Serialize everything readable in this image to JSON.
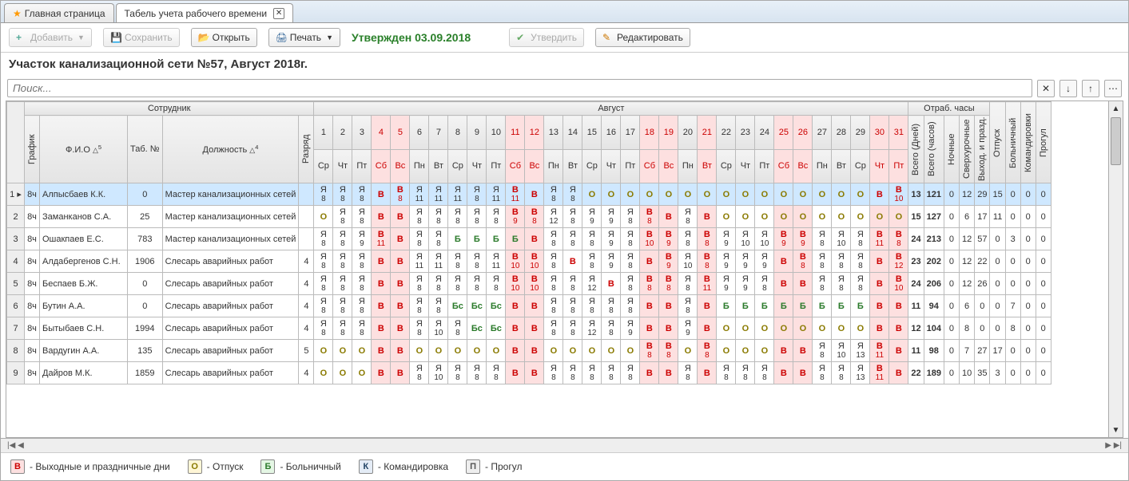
{
  "tabs": [
    {
      "label": "Главная страница",
      "star": true,
      "active": false
    },
    {
      "label": "Табель учета рабочего времени",
      "active": true,
      "closable": true
    }
  ],
  "toolbar": {
    "add": "Добавить",
    "save": "Сохранить",
    "open": "Открыть",
    "print": "Печать",
    "approve": "Утвердить",
    "edit": "Редактировать"
  },
  "status": "Утвержден 03.09.2018",
  "title": "Участок канализационной сети №57, Август 2018г.",
  "search_placeholder": "Поиск...",
  "month_label": "Август",
  "headers": {
    "employee": "Сотрудник",
    "schedule": "График",
    "fio": "Ф.И.О",
    "tabno": "Таб. №",
    "position": "Должность",
    "rank": "Разряд",
    "hours_group": "Отраб. часы",
    "days_total": "Всего (Дней)",
    "hours_total": "Всего (часов)",
    "night": "Ночные",
    "overtime": "Сверхурочные",
    "holiday": "Выход. и празд.",
    "vacation": "Отпуск",
    "sick": "Больничный",
    "trip": "Командировки",
    "absence": "Прогул"
  },
  "days": [
    {
      "n": "1",
      "w": "Ср"
    },
    {
      "n": "2",
      "w": "Чт"
    },
    {
      "n": "3",
      "w": "Пт"
    },
    {
      "n": "4",
      "w": "Сб",
      "wk": true
    },
    {
      "n": "5",
      "w": "Вс",
      "wk": true
    },
    {
      "n": "6",
      "w": "Пн"
    },
    {
      "n": "7",
      "w": "Вт"
    },
    {
      "n": "8",
      "w": "Ср"
    },
    {
      "n": "9",
      "w": "Чт"
    },
    {
      "n": "10",
      "w": "Пт"
    },
    {
      "n": "11",
      "w": "Сб",
      "wk": true
    },
    {
      "n": "12",
      "w": "Вс",
      "wk": true
    },
    {
      "n": "13",
      "w": "Пн"
    },
    {
      "n": "14",
      "w": "Вт"
    },
    {
      "n": "15",
      "w": "Ср"
    },
    {
      "n": "16",
      "w": "Чт"
    },
    {
      "n": "17",
      "w": "Пт"
    },
    {
      "n": "18",
      "w": "Сб",
      "wk": true
    },
    {
      "n": "19",
      "w": "Вс",
      "wk": true
    },
    {
      "n": "20",
      "w": "Пн"
    },
    {
      "n": "21",
      "w": "Вт",
      "wk": true
    },
    {
      "n": "22",
      "w": "Ср"
    },
    {
      "n": "23",
      "w": "Чт"
    },
    {
      "n": "24",
      "w": "Пт"
    },
    {
      "n": "25",
      "w": "Сб",
      "wk": true
    },
    {
      "n": "26",
      "w": "Вс",
      "wk": true
    },
    {
      "n": "27",
      "w": "Пн"
    },
    {
      "n": "28",
      "w": "Вт"
    },
    {
      "n": "29",
      "w": "Ср"
    },
    {
      "n": "30",
      "w": "Чт",
      "wk": true
    },
    {
      "n": "31",
      "w": "Пт",
      "wk": true
    }
  ],
  "rows": [
    {
      "n": 1,
      "sel": true,
      "sched": "8ч",
      "fio": "Алпысбаев К.К.",
      "tab": "0",
      "pos": "Мастер канализационных сетей",
      "rank": "",
      "cells": [
        [
          "Я",
          "8"
        ],
        [
          "Я",
          "8"
        ],
        [
          "Я",
          "8"
        ],
        [
          "В",
          ""
        ],
        [
          "В",
          "8"
        ],
        [
          "Я",
          "11"
        ],
        [
          "Я",
          "11"
        ],
        [
          "Я",
          "11"
        ],
        [
          "Я",
          "8"
        ],
        [
          "Я",
          "11"
        ],
        [
          "В",
          "11"
        ],
        [
          "В",
          ""
        ],
        [
          "Я",
          "8"
        ],
        [
          "Я",
          "8"
        ],
        [
          "О",
          ""
        ],
        [
          "О",
          ""
        ],
        [
          "О",
          ""
        ],
        [
          "О",
          ""
        ],
        [
          "О",
          ""
        ],
        [
          "О",
          ""
        ],
        [
          "О",
          ""
        ],
        [
          "О",
          ""
        ],
        [
          "О",
          ""
        ],
        [
          "О",
          ""
        ],
        [
          "О",
          ""
        ],
        [
          "О",
          ""
        ],
        [
          "О",
          ""
        ],
        [
          "О",
          ""
        ],
        [
          "О",
          ""
        ],
        [
          "В",
          ""
        ],
        [
          "В",
          "10"
        ]
      ],
      "totals": [
        "13",
        "121",
        "0",
        "12",
        "29",
        "15",
        "0",
        "0",
        "0"
      ]
    },
    {
      "n": 2,
      "sched": "8ч",
      "fio": "Заманканов С.А.",
      "tab": "25",
      "pos": "Мастер канализационных сетей",
      "rank": "",
      "cells": [
        [
          "О",
          ""
        ],
        [
          "Я",
          "8"
        ],
        [
          "Я",
          "8"
        ],
        [
          "В",
          ""
        ],
        [
          "В",
          ""
        ],
        [
          "Я",
          "8"
        ],
        [
          "Я",
          "8"
        ],
        [
          "Я",
          "8"
        ],
        [
          "Я",
          "8"
        ],
        [
          "Я",
          "8"
        ],
        [
          "В",
          "9"
        ],
        [
          "В",
          "8"
        ],
        [
          "Я",
          "12"
        ],
        [
          "Я",
          "8"
        ],
        [
          "Я",
          "9"
        ],
        [
          "Я",
          "9"
        ],
        [
          "Я",
          "8"
        ],
        [
          "В",
          "8"
        ],
        [
          "В",
          ""
        ],
        [
          "Я",
          "8"
        ],
        [
          "В",
          ""
        ],
        [
          "О",
          ""
        ],
        [
          "О",
          ""
        ],
        [
          "О",
          ""
        ],
        [
          "О",
          ""
        ],
        [
          "О",
          ""
        ],
        [
          "О",
          ""
        ],
        [
          "О",
          ""
        ],
        [
          "О",
          ""
        ],
        [
          "О",
          ""
        ],
        [
          "О",
          ""
        ]
      ],
      "totals": [
        "15",
        "127",
        "0",
        "6",
        "17",
        "11",
        "0",
        "0",
        "0"
      ]
    },
    {
      "n": 3,
      "sched": "8ч",
      "fio": "Ошакпаев Е.С.",
      "tab": "783",
      "pos": "Мастер канализационных сетей",
      "rank": "",
      "cells": [
        [
          "Я",
          "8"
        ],
        [
          "Я",
          "8"
        ],
        [
          "Я",
          "9"
        ],
        [
          "В",
          "11"
        ],
        [
          "В",
          ""
        ],
        [
          "Я",
          "8"
        ],
        [
          "Я",
          "8"
        ],
        [
          "Б",
          ""
        ],
        [
          "Б",
          ""
        ],
        [
          "Б",
          ""
        ],
        [
          "Б",
          ""
        ],
        [
          "В",
          ""
        ],
        [
          "Я",
          "8"
        ],
        [
          "Я",
          "8"
        ],
        [
          "Я",
          "8"
        ],
        [
          "Я",
          "9"
        ],
        [
          "Я",
          "8"
        ],
        [
          "В",
          "10"
        ],
        [
          "В",
          "9"
        ],
        [
          "Я",
          "8"
        ],
        [
          "В",
          "8"
        ],
        [
          "Я",
          "9"
        ],
        [
          "Я",
          "10"
        ],
        [
          "Я",
          "10"
        ],
        [
          "В",
          "9"
        ],
        [
          "В",
          "9"
        ],
        [
          "Я",
          "8"
        ],
        [
          "Я",
          "10"
        ],
        [
          "Я",
          "8"
        ],
        [
          "В",
          "11"
        ],
        [
          "В",
          "8"
        ]
      ],
      "totals": [
        "24",
        "213",
        "0",
        "12",
        "57",
        "0",
        "3",
        "0",
        "0"
      ]
    },
    {
      "n": 4,
      "sched": "8ч",
      "fio": "Алдабергенов С.Н.",
      "tab": "1906",
      "pos": "Слесарь аварийных работ",
      "rank": "4",
      "cells": [
        [
          "Я",
          "8"
        ],
        [
          "Я",
          "8"
        ],
        [
          "Я",
          "8"
        ],
        [
          "В",
          ""
        ],
        [
          "В",
          ""
        ],
        [
          "Я",
          "11"
        ],
        [
          "Я",
          "11"
        ],
        [
          "Я",
          "8"
        ],
        [
          "Я",
          "8"
        ],
        [
          "Я",
          "11"
        ],
        [
          "В",
          "10"
        ],
        [
          "В",
          "10"
        ],
        [
          "Я",
          "8"
        ],
        [
          "В",
          ""
        ],
        [
          "Я",
          "8"
        ],
        [
          "Я",
          "9"
        ],
        [
          "Я",
          "8"
        ],
        [
          "В",
          ""
        ],
        [
          "В",
          "9"
        ],
        [
          "Я",
          "10"
        ],
        [
          "В",
          "8"
        ],
        [
          "Я",
          "9"
        ],
        [
          "Я",
          "9"
        ],
        [
          "Я",
          "9"
        ],
        [
          "В",
          ""
        ],
        [
          "В",
          "8"
        ],
        [
          "Я",
          "8"
        ],
        [
          "Я",
          "8"
        ],
        [
          "Я",
          "8"
        ],
        [
          "В",
          ""
        ],
        [
          "В",
          "12"
        ]
      ],
      "totals": [
        "23",
        "202",
        "0",
        "12",
        "22",
        "0",
        "0",
        "0",
        "0"
      ]
    },
    {
      "n": 5,
      "sched": "8ч",
      "fio": "Беспаев Б.Ж.",
      "tab": "0",
      "pos": "Слесарь аварийных работ",
      "rank": "4",
      "cells": [
        [
          "Я",
          "8"
        ],
        [
          "Я",
          "8"
        ],
        [
          "Я",
          "8"
        ],
        [
          "В",
          ""
        ],
        [
          "В",
          ""
        ],
        [
          "Я",
          "8"
        ],
        [
          "Я",
          "8"
        ],
        [
          "Я",
          "8"
        ],
        [
          "Я",
          "8"
        ],
        [
          "Я",
          "8"
        ],
        [
          "В",
          "10"
        ],
        [
          "В",
          "10"
        ],
        [
          "Я",
          "8"
        ],
        [
          "Я",
          "8"
        ],
        [
          "Я",
          "12"
        ],
        [
          "В",
          ""
        ],
        [
          "Я",
          "8"
        ],
        [
          "В",
          "8"
        ],
        [
          "В",
          "8"
        ],
        [
          "Я",
          "8"
        ],
        [
          "В",
          "11"
        ],
        [
          "Я",
          "9"
        ],
        [
          "Я",
          "9"
        ],
        [
          "Я",
          "8"
        ],
        [
          "В",
          ""
        ],
        [
          "В",
          ""
        ],
        [
          "Я",
          "8"
        ],
        [
          "Я",
          "8"
        ],
        [
          "Я",
          "8"
        ],
        [
          "В",
          ""
        ],
        [
          "В",
          "10"
        ]
      ],
      "totals": [
        "24",
        "206",
        "0",
        "12",
        "26",
        "0",
        "0",
        "0",
        "0"
      ]
    },
    {
      "n": 6,
      "sched": "8ч",
      "fio": "Бутин А.А.",
      "tab": "0",
      "pos": "Слесарь аварийных работ",
      "rank": "4",
      "cells": [
        [
          "Я",
          "8"
        ],
        [
          "Я",
          "8"
        ],
        [
          "Я",
          "8"
        ],
        [
          "В",
          ""
        ],
        [
          "В",
          ""
        ],
        [
          "Я",
          "8"
        ],
        [
          "Я",
          "8"
        ],
        [
          "Бс",
          ""
        ],
        [
          "Бс",
          ""
        ],
        [
          "Бс",
          ""
        ],
        [
          "В",
          ""
        ],
        [
          "В",
          ""
        ],
        [
          "Я",
          "8"
        ],
        [
          "Я",
          "8"
        ],
        [
          "Я",
          "8"
        ],
        [
          "Я",
          "8"
        ],
        [
          "Я",
          "8"
        ],
        [
          "В",
          ""
        ],
        [
          "В",
          ""
        ],
        [
          "Я",
          "8"
        ],
        [
          "В",
          ""
        ],
        [
          "Б",
          ""
        ],
        [
          "Б",
          ""
        ],
        [
          "Б",
          ""
        ],
        [
          "Б",
          ""
        ],
        [
          "Б",
          ""
        ],
        [
          "Б",
          ""
        ],
        [
          "Б",
          ""
        ],
        [
          "Б",
          ""
        ],
        [
          "В",
          ""
        ],
        [
          "В",
          ""
        ]
      ],
      "totals": [
        "11",
        "94",
        "0",
        "6",
        "0",
        "0",
        "7",
        "0",
        "0"
      ]
    },
    {
      "n": 7,
      "sched": "8ч",
      "fio": "Бытыбаев С.Н.",
      "tab": "1994",
      "pos": "Слесарь аварийных работ",
      "rank": "4",
      "cells": [
        [
          "Я",
          "8"
        ],
        [
          "Я",
          "8"
        ],
        [
          "Я",
          "8"
        ],
        [
          "В",
          ""
        ],
        [
          "В",
          ""
        ],
        [
          "Я",
          "8"
        ],
        [
          "Я",
          "10"
        ],
        [
          "Я",
          "8"
        ],
        [
          "Бс",
          ""
        ],
        [
          "Бс",
          ""
        ],
        [
          "В",
          ""
        ],
        [
          "В",
          ""
        ],
        [
          "Я",
          "8"
        ],
        [
          "Я",
          "8"
        ],
        [
          "Я",
          "12"
        ],
        [
          "Я",
          "8"
        ],
        [
          "Я",
          "9"
        ],
        [
          "В",
          ""
        ],
        [
          "В",
          ""
        ],
        [
          "Я",
          "9"
        ],
        [
          "В",
          ""
        ],
        [
          "О",
          ""
        ],
        [
          "О",
          ""
        ],
        [
          "О",
          ""
        ],
        [
          "О",
          ""
        ],
        [
          "О",
          ""
        ],
        [
          "О",
          ""
        ],
        [
          "О",
          ""
        ],
        [
          "О",
          ""
        ],
        [
          "В",
          ""
        ],
        [
          "В",
          ""
        ]
      ],
      "totals": [
        "12",
        "104",
        "0",
        "8",
        "0",
        "0",
        "8",
        "0",
        "0"
      ]
    },
    {
      "n": 8,
      "sched": "8ч",
      "fio": "Вардугин А.А.",
      "tab": "135",
      "pos": "Слесарь аварийных работ",
      "rank": "5",
      "cells": [
        [
          "О",
          ""
        ],
        [
          "О",
          ""
        ],
        [
          "О",
          ""
        ],
        [
          "В",
          ""
        ],
        [
          "В",
          ""
        ],
        [
          "О",
          ""
        ],
        [
          "О",
          ""
        ],
        [
          "О",
          ""
        ],
        [
          "О",
          ""
        ],
        [
          "О",
          ""
        ],
        [
          "В",
          ""
        ],
        [
          "В",
          ""
        ],
        [
          "О",
          ""
        ],
        [
          "О",
          ""
        ],
        [
          "О",
          ""
        ],
        [
          "О",
          ""
        ],
        [
          "О",
          ""
        ],
        [
          "В",
          "8"
        ],
        [
          "В",
          "8"
        ],
        [
          "О",
          ""
        ],
        [
          "В",
          "8"
        ],
        [
          "О",
          ""
        ],
        [
          "О",
          ""
        ],
        [
          "О",
          ""
        ],
        [
          "В",
          ""
        ],
        [
          "В",
          ""
        ],
        [
          "Я",
          "8"
        ],
        [
          "Я",
          "10"
        ],
        [
          "Я",
          "13"
        ],
        [
          "В",
          "11"
        ],
        [
          "В",
          ""
        ]
      ],
      "totals": [
        "11",
        "98",
        "0",
        "7",
        "27",
        "17",
        "0",
        "0",
        "0"
      ]
    },
    {
      "n": 9,
      "sched": "8ч",
      "fio": "Дайров М.К.",
      "tab": "1859",
      "pos": "Слесарь аварийных работ",
      "rank": "4",
      "cells": [
        [
          "О",
          ""
        ],
        [
          "О",
          ""
        ],
        [
          "О",
          ""
        ],
        [
          "В",
          ""
        ],
        [
          "В",
          ""
        ],
        [
          "Я",
          "8"
        ],
        [
          "Я",
          "10"
        ],
        [
          "Я",
          "8"
        ],
        [
          "Я",
          "8"
        ],
        [
          "Я",
          "8"
        ],
        [
          "В",
          ""
        ],
        [
          "В",
          ""
        ],
        [
          "Я",
          "8"
        ],
        [
          "Я",
          "8"
        ],
        [
          "Я",
          "8"
        ],
        [
          "Я",
          "8"
        ],
        [
          "Я",
          "8"
        ],
        [
          "В",
          ""
        ],
        [
          "В",
          ""
        ],
        [
          "Я",
          "8"
        ],
        [
          "В",
          ""
        ],
        [
          "Я",
          "8"
        ],
        [
          "Я",
          "8"
        ],
        [
          "Я",
          "8"
        ],
        [
          "В",
          ""
        ],
        [
          "В",
          ""
        ],
        [
          "Я",
          "8"
        ],
        [
          "Я",
          "8"
        ],
        [
          "Я",
          "13"
        ],
        [
          "В",
          "11"
        ],
        [
          "В",
          ""
        ]
      ],
      "totals": [
        "22",
        "189",
        "0",
        "10",
        "35",
        "3",
        "0",
        "0",
        "0"
      ]
    }
  ],
  "legend": [
    {
      "code": "В",
      "cls": "B",
      "label": "- Выходные и праздничные дни"
    },
    {
      "code": "О",
      "cls": "O",
      "label": "- Отпуск"
    },
    {
      "code": "Б",
      "cls": "b",
      "label": "- Больничный"
    },
    {
      "code": "К",
      "cls": "K",
      "label": "- Командировка"
    },
    {
      "code": "П",
      "cls": "P",
      "label": "- Прогул"
    }
  ]
}
